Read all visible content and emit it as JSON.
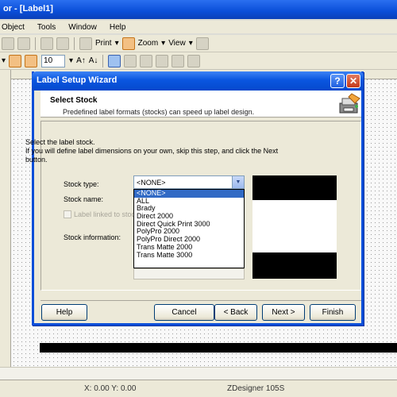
{
  "app": {
    "title": "or - [Label1]",
    "menu": [
      "Object",
      "Tools",
      "Window",
      "Help"
    ],
    "toolbar": {
      "print_label": "Print",
      "zoom_label": "Zoom",
      "view_label": "View",
      "font_size": "10"
    },
    "status": {
      "xy": "X: 0.00 Y: 0.00",
      "printer": "ZDesigner 105S"
    }
  },
  "dialog": {
    "title": "Label Setup Wizard",
    "help_glyph": "?",
    "close_glyph": "✕",
    "header_title": "Select Stock",
    "header_subtitle": "Predefined label formats (stocks) can speed up label design.",
    "instruction_1": "Select the label stock.",
    "instruction_2": "If you will define label dimensions on your own, skip this step, and click the Next button.",
    "stock_type_label": "Stock type:",
    "stock_name_label": "Stock name:",
    "checkbox_label": "Label linked to stock",
    "stock_info_label": "Stock information:",
    "stock_type_value": "<NONE>",
    "stock_types": [
      "<NONE>",
      "ALL",
      "Brady",
      "Direct 2000",
      "Direct Quick Print 3000",
      "PolyPro 2000",
      "PolyPro Direct 2000",
      "Trans Matte 2000",
      "Trans Matte 3000"
    ],
    "buttons": {
      "help": "Help",
      "cancel": "Cancel",
      "back": "< Back",
      "next": "Next >",
      "finish": "Finish"
    }
  }
}
